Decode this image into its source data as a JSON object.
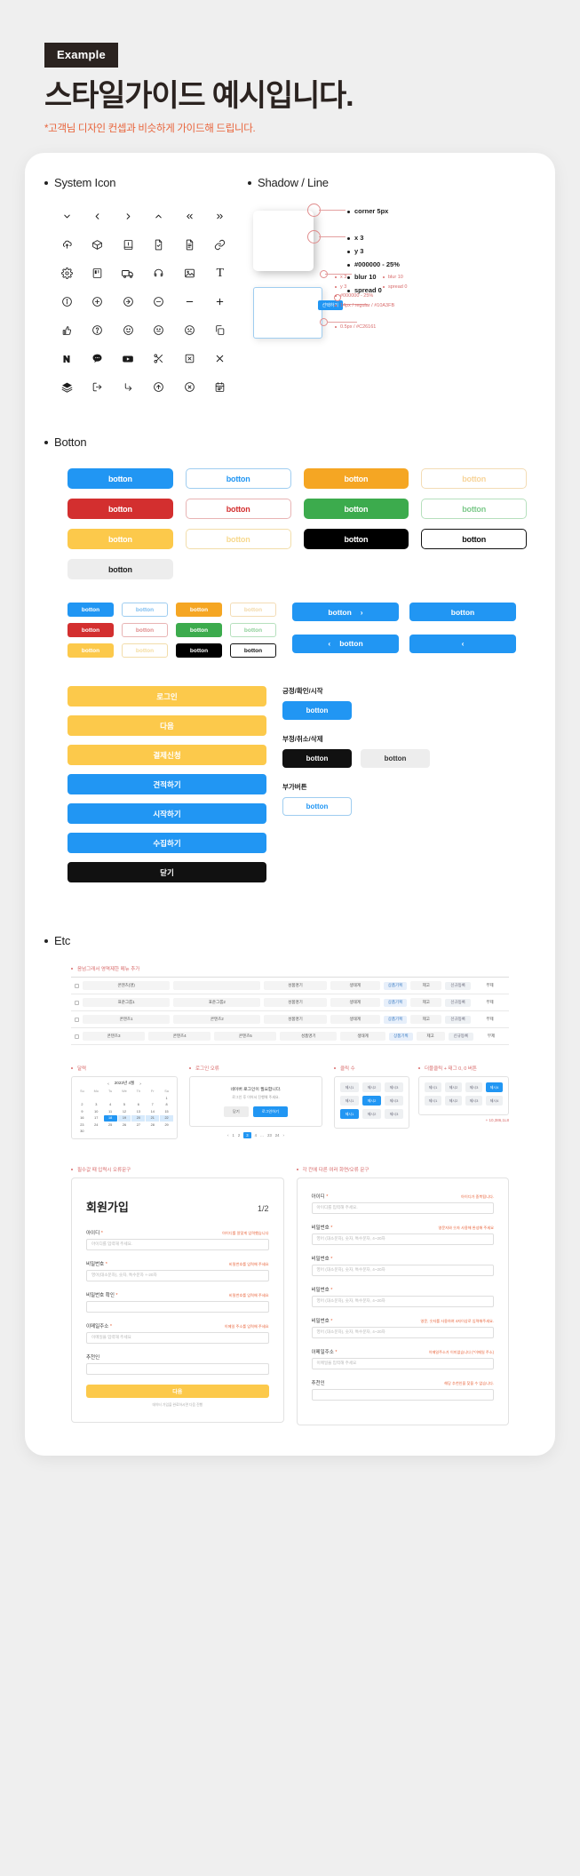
{
  "header": {
    "badge": "Example",
    "title": "스타일가이드 예시입니다.",
    "subtitle": "*고객님 디자인 컨셉과 비슷하게 가이드해 드립니다."
  },
  "sections": {
    "system_icon": "System Icon",
    "shadow_line": "Shadow / Line",
    "botton": "Botton",
    "etc": "Etc"
  },
  "icons": [
    [
      "chevron-down-icon",
      "chevron-left-icon",
      "chevron-right-icon",
      "chevron-up-icon",
      "chevrons-left-icon",
      "chevrons-right-icon"
    ],
    [
      "cloud-upload-icon",
      "box-icon",
      "book-icon",
      "file-check-icon",
      "file-text-icon",
      "link-icon"
    ],
    [
      "gear-icon",
      "kanban-icon",
      "truck-icon",
      "headphones-icon",
      "image-icon",
      "text-icon"
    ],
    [
      "info-circle-icon",
      "plus-circle-icon",
      "arrow-right-circle-icon",
      "minus-circle-icon",
      "minus-icon",
      "plus-icon"
    ],
    [
      "thumbs-up-icon",
      "question-circle-icon",
      "smile-icon",
      "neutral-face-icon",
      "frown-icon",
      "copy-icon"
    ],
    [
      "naver-icon",
      "kakao-icon",
      "youtube-icon",
      "scissors-icon",
      "x-square-icon",
      "close-icon"
    ],
    [
      "layers-icon",
      "logout-icon",
      "corner-down-right-icon",
      "arrow-up-circle-icon",
      "x-circle-icon",
      "calendar-icon"
    ]
  ],
  "shadow": {
    "specs": [
      "corner 5px",
      "x 3",
      "y 3",
      "#000000 - 25%",
      "blur  10",
      "spread 0"
    ],
    "line_specs_left": [
      "x 3",
      "y 3",
      "#000000 - 25%"
    ],
    "line_specs_right": [
      "blur  10",
      "spread 0"
    ],
    "line_specs_bottom": [
      "14px / regular / #10A3FB",
      "0.5px / #C26161"
    ],
    "chip_label": "선택하기"
  },
  "buttons": {
    "label": "botton",
    "grid": [
      [
        {
          "style": "solid",
          "bg": "#2196f3",
          "fg": "#ffffff"
        },
        {
          "style": "ghost",
          "bg": "#ffffff",
          "fg": "#2196f3",
          "border": "#9fcdf0"
        },
        {
          "style": "solid",
          "bg": "#f5a623",
          "fg": "#ffffff"
        },
        {
          "style": "ghost",
          "bg": "#ffffff",
          "fg": "#f7d49a",
          "border": "#f3dcb5"
        }
      ],
      [
        {
          "style": "solid",
          "bg": "#d32f2f",
          "fg": "#ffffff"
        },
        {
          "style": "ghost",
          "bg": "#ffffff",
          "fg": "#d32f2f",
          "border": "#e8b4b4"
        },
        {
          "style": "solid",
          "bg": "#3cab4d",
          "fg": "#ffffff"
        },
        {
          "style": "ghost",
          "bg": "#ffffff",
          "fg": "#7cc98a",
          "border": "#b6e0bd"
        }
      ],
      [
        {
          "style": "solid",
          "bg": "#fcc94b",
          "fg": "#ffffff"
        },
        {
          "style": "ghost",
          "bg": "#ffffff",
          "fg": "#f7d98f",
          "border": "#f2ddaa"
        },
        {
          "style": "solid",
          "bg": "#000000",
          "fg": "#ffffff"
        },
        {
          "style": "ghost",
          "bg": "#ffffff",
          "fg": "#111111",
          "border": "#111111"
        }
      ],
      [
        {
          "style": "solid",
          "bg": "#ededed",
          "fg": "#222222"
        }
      ]
    ],
    "small_grid": [
      [
        {
          "bg": "#2196f3",
          "fg": "#ffffff"
        },
        {
          "bg": "#ffffff",
          "fg": "#7cbdf0",
          "border": "#9fcdf0"
        },
        {
          "bg": "#f5a623",
          "fg": "#ffffff"
        },
        {
          "bg": "#ffffff",
          "fg": "#f3d9a8",
          "border": "#f3dcb5"
        }
      ],
      [
        {
          "bg": "#d32f2f",
          "fg": "#ffffff"
        },
        {
          "bg": "#ffffff",
          "fg": "#e08c8c",
          "border": "#e8b4b4"
        },
        {
          "bg": "#3cab4d",
          "fg": "#ffffff"
        },
        {
          "bg": "#ffffff",
          "fg": "#8fd09a",
          "border": "#b6e0bd"
        }
      ],
      [
        {
          "bg": "#fcc94b",
          "fg": "#ffffff"
        },
        {
          "bg": "#ffffff",
          "fg": "#f5dda0",
          "border": "#f2ddaa"
        },
        {
          "bg": "#000000",
          "fg": "#ffffff"
        },
        {
          "bg": "#ffffff",
          "fg": "#111111",
          "border": "#111111"
        }
      ]
    ],
    "arrow_buttons": [
      {
        "label": "botton",
        "arrow": "›",
        "side": "right"
      },
      {
        "label": "botton",
        "arrow": "",
        "side": "none"
      },
      {
        "label": "botton",
        "arrow": "‹",
        "side": "left"
      },
      {
        "label": "",
        "arrow": "‹",
        "side": "only"
      }
    ],
    "tall_list": [
      {
        "label": "로그인",
        "bg": "#fcc94b"
      },
      {
        "label": "다음",
        "bg": "#fcc94b"
      },
      {
        "label": "결제신청",
        "bg": "#fcc94b"
      },
      {
        "label": "견적하기",
        "bg": "#2196f3"
      },
      {
        "label": "시작하기",
        "bg": "#2196f3"
      },
      {
        "label": "수집하기",
        "bg": "#2196f3"
      },
      {
        "label": "닫기",
        "bg": "#111111"
      }
    ],
    "groups": [
      {
        "label": "긍정/확인/시작",
        "items": [
          {
            "label": "botton",
            "bg": "#2196f3",
            "fg": "#ffffff"
          }
        ]
      },
      {
        "label": "부정/취소/삭제",
        "items": [
          {
            "label": "botton",
            "bg": "#111111",
            "fg": "#ffffff"
          },
          {
            "label": "botton",
            "bg": "#ededed",
            "fg": "#333333"
          }
        ]
      },
      {
        "label": "부가버튼",
        "items": [
          {
            "label": "botton",
            "bg": "#ffffff",
            "fg": "#2196f3",
            "border": "#9fcdf0"
          }
        ]
      }
    ]
  },
  "etc": {
    "table_note": "음넘그래서 영역제한 메뉴 추가",
    "table_rows": [
      {
        "cells": [
          "콘텐츠(명)",
          "",
          "성품명기",
          "생태계",
          "상품기획",
          "제고",
          "신규등록",
          "부제"
        ]
      },
      {
        "cells": [
          "표준그룹1",
          "표준그룹2",
          "성품명기",
          "생태계",
          "상품기획",
          "제고",
          "신규등록",
          "부제"
        ]
      },
      {
        "cells": [
          "콘텐츠1",
          "콘텐츠2",
          "성품명기",
          "생태계",
          "상품기획",
          "제고",
          "신규등록",
          "부제"
        ]
      },
      {
        "cells": [
          "콘텐츠3",
          "콘텐츠4",
          "콘텐츠5",
          "성품명기",
          "생태계",
          "상품기획",
          "제고",
          "신규등록",
          "부제"
        ]
      }
    ],
    "calendar": {
      "title": "달력",
      "month": "2023년 4월",
      "weekdays": [
        "Su",
        "Mo",
        "Tu",
        "We",
        "Th",
        "Fr",
        "Sa"
      ],
      "days": [
        "",
        "",
        "",
        "",
        "",
        "",
        "1",
        "2",
        "3",
        "4",
        "5",
        "6",
        "7",
        "8",
        "9",
        "10",
        "11",
        "12",
        "13",
        "14",
        "15",
        "16",
        "17",
        "18",
        "19",
        "20",
        "21",
        "22",
        "23",
        "24",
        "25",
        "26",
        "27",
        "28",
        "29",
        "30"
      ],
      "selected": "18",
      "range": [
        "19",
        "20",
        "21",
        "22"
      ]
    },
    "login": {
      "title": "로그인 오류",
      "message": "네이버 로그인이 필요합니다.",
      "sub": "로그인 후 이어서 진행해 주세요.",
      "cancel": "닫기",
      "confirm": "로그인하기",
      "pages": [
        "‹",
        "1",
        "2",
        "3",
        "4",
        "…",
        "23",
        "24",
        "›"
      ],
      "current": "3"
    },
    "chips1": {
      "title": "클릭 수",
      "rows": [
        [
          "제시1",
          "제시2",
          "제시3"
        ],
        [
          "제시1",
          "제시2",
          "제시3"
        ],
        [
          "제시1",
          "제시2",
          "제시3"
        ]
      ],
      "active": "제시2"
    },
    "chips2": {
      "title": "더블클릭 + 태그 0, 0 버튼",
      "rows": [
        [
          "제시1",
          "제시2",
          "제시3",
          "제시4"
        ],
        [
          "제시1",
          "제시2",
          "제시3",
          "제시4"
        ]
      ],
      "active": "제시3",
      "total": "+ 10,386,1L8"
    }
  },
  "forms": {
    "left": {
      "note": "필수값 때 입력시 오류문구",
      "title": "회원가입",
      "step": "1/2",
      "fields": [
        {
          "label": "아이디",
          "req": "*",
          "hint": "아이디를 알맞게 입력했습니다",
          "placeholder": "아이디를 입력해 주세요."
        },
        {
          "label": "비밀번호",
          "req": "*",
          "hint": "비밀번호를 입력해 주세요",
          "placeholder": "영어(대소문자), 숫자, 특수문자 +-20자"
        },
        {
          "label": "비밀번호 확인",
          "req": "*",
          "hint": "비밀번호를 입력해 주세요",
          "placeholder": ""
        },
        {
          "label": "이메일주소",
          "req": "*",
          "hint": "이메일 주소를 입력해 주세요",
          "placeholder": "이메일을 입력해 주세요"
        },
        {
          "label": "추천인",
          "req": "",
          "hint": "",
          "placeholder": ""
        }
      ],
      "submit": "다음",
      "footer": "데이터 가입을 완료하시면 다음 진행"
    },
    "right": {
      "note": "각 칸에 다른 여러 화면/오류 문구",
      "fields": [
        {
          "label": "아이디",
          "req": "*",
          "hint": "아이디가 중복됩니다.",
          "placeholder": "아이디를 입력해 주세요."
        },
        {
          "label": "비밀번호",
          "req": "*",
          "hint": "영문자와 숫자 사용해 완성해 주세요",
          "placeholder": "영어 (대소문자), 숫자, 특수문자, 4~20자"
        },
        {
          "label": "비밀번호",
          "req": "*",
          "hint": "",
          "placeholder": "영어 (대소문자), 숫자, 특수문자, 4~20자"
        },
        {
          "label": "비밀번호",
          "req": "*",
          "hint": "",
          "placeholder": "영어 (대소문자), 숫자, 특수문자, 4~20자"
        },
        {
          "label": "비밀번호",
          "req": "*",
          "hint": "영문, 숫자를 사용하여 4자이상로 입력해주세요.",
          "placeholder": "영어 (대소문자), 숫자, 특수문자, 4~20자"
        },
        {
          "label": "이메일주소",
          "req": "*",
          "hint": "이메일주소가 이미없습니다 (*이메일 주소)",
          "placeholder": "이메일을 입력해 주세요"
        },
        {
          "label": "추천인",
          "req": "",
          "hint": "해당 추천인을 찾을 수 없습니다.",
          "placeholder": ""
        }
      ]
    }
  }
}
